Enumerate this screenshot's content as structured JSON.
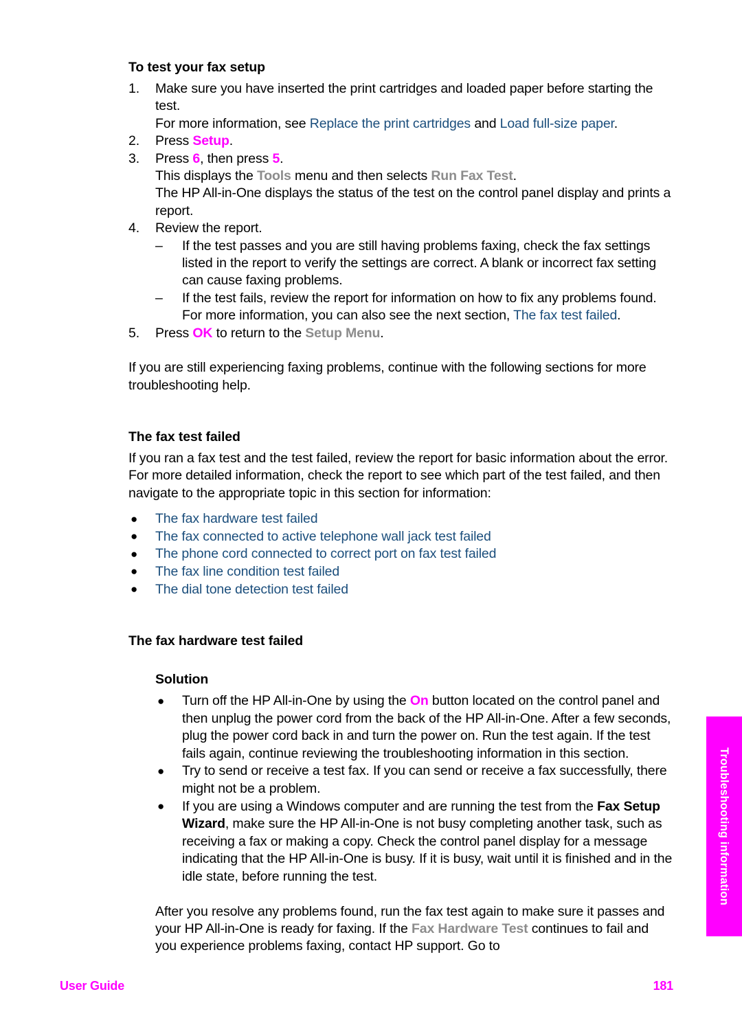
{
  "document": {
    "heading_1": "To test your fax setup",
    "numbered_steps": [
      {
        "num": "1.",
        "line_1": "Make sure you have inserted the print cartridges and loaded paper before starting the test.",
        "line_2_prefix": "For more information, see ",
        "line_2_link_1": "Replace the print cartridges",
        "line_2_mid": " and ",
        "line_2_link_2": "Load full-size paper",
        "line_2_suffix": "."
      },
      {
        "num": "2.",
        "prefix": "Press ",
        "emphasis": "Setup",
        "suffix": "."
      },
      {
        "num": "3.",
        "prefix": "Press ",
        "key_1": "6",
        "mid": ", then press ",
        "key_2": "5",
        "suffix": ".",
        "sub_line_1_prefix": "This displays the ",
        "sub_line_1_menu": "Tools",
        "sub_line_1_mid": " menu and then selects ",
        "sub_line_1_item": "Run Fax Test",
        "sub_line_1_suffix": ".",
        "sub_line_2": "The HP All-in-One displays the status of the test on the control panel display and prints a report."
      },
      {
        "num": "4.",
        "line_1": "Review the report."
      },
      {
        "num": "5.",
        "prefix": "Press ",
        "key": "OK",
        "mid": " to return to the ",
        "menu": "Setup Menu",
        "suffix": "."
      }
    ],
    "dash_items": [
      {
        "dash": "–",
        "text": "If the test passes and you are still having problems faxing, check the fax settings listed in the report to verify the settings are correct. A blank or incorrect fax setting can cause faxing problems."
      },
      {
        "dash": "–",
        "text_prefix": "If the test fails, review the report for information on how to fix any problems found. For more information, you can also see the next section, ",
        "link": "The fax test failed",
        "text_suffix": "."
      }
    ],
    "paragraph_after_steps": "If you are still experiencing faxing problems, continue with the following sections for more troubleshooting help.",
    "heading_2": "The fax test failed",
    "paragraph_fax_test_failed": "If you ran a fax test and the test failed, review the report for basic information about the error. For more detailed information, check the report to see which part of the test failed, and then navigate to the appropriate topic in this section for information:",
    "link_list": [
      {
        "bullet": "●",
        "label": "The fax hardware test failed"
      },
      {
        "bullet": "●",
        "label": "The fax connected to active telephone wall jack test failed"
      },
      {
        "bullet": "●",
        "label": "The phone cord connected to correct port on fax test failed"
      },
      {
        "bullet": "●",
        "label": "The fax line condition test failed"
      },
      {
        "bullet": "●",
        "label": "The dial tone detection test failed"
      }
    ],
    "heading_3": "The fax hardware test failed",
    "heading_solution": "Solution",
    "solution_bullets": [
      {
        "bullet": "●",
        "prefix": "Turn off the HP All-in-One by using the ",
        "emphasis": "On",
        "suffix": " button located on the control panel and then unplug the power cord from the back of the HP All-in-One. After a few seconds, plug the power cord back in and turn the power on. Run the test again. If the test fails again, continue reviewing the troubleshooting information in this section."
      },
      {
        "bullet": "●",
        "text": "Try to send or receive a test fax. If you can send or receive a fax successfully, there might not be a problem."
      },
      {
        "bullet": "●",
        "prefix": "If you are using a Windows computer and are running the test from the ",
        "emphasis": "Fax Setup Wizard",
        "suffix": ", make sure the HP All-in-One is not busy completing another task, such as receiving a fax or making a copy. Check the control panel display for a message indicating that the HP All-in-One is busy. If it is busy, wait until it is finished and in the idle state, before running the test."
      }
    ],
    "closing_paragraph": {
      "prefix": "After you resolve any problems found, run the fax test again to make sure it passes and your HP All-in-One is ready for faxing. If the ",
      "emphasis": "Fax Hardware Test",
      "suffix": " continues to fail and you experience problems faxing, contact HP support. Go to"
    }
  },
  "side_tab": {
    "label": "Troubleshooting information",
    "color": "#ff00ff"
  },
  "footer": {
    "left": "User Guide",
    "page_number": "181",
    "color": "#ff00ff"
  },
  "colors": {
    "link_blue": "#1b4e7c",
    "magenta": "#ff00ff",
    "menu_gray": "#8c8c8c",
    "text_black": "#000000"
  }
}
